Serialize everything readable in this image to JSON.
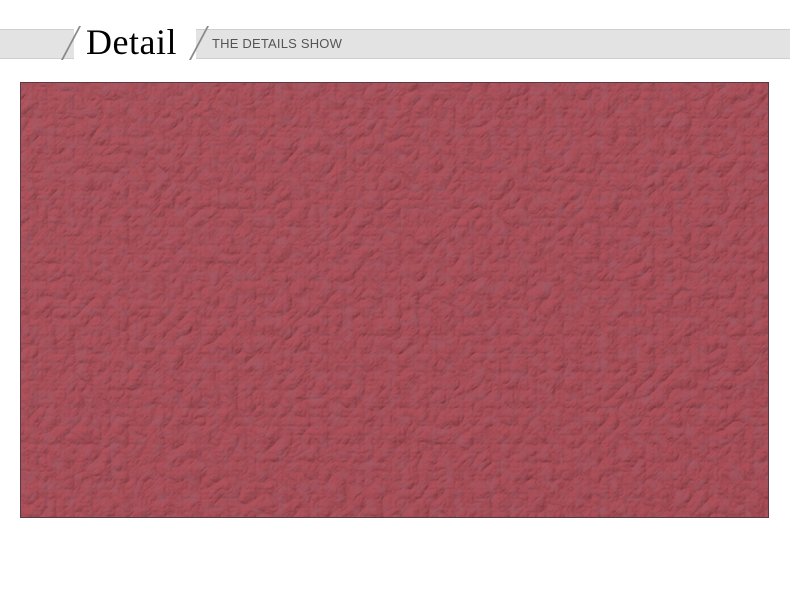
{
  "header": {
    "title": "Detail",
    "subtitle": "THE DETAILS SHOW"
  },
  "detail_image": {
    "subject": "pink-leather-texture",
    "colors": {
      "base": "#c06e78",
      "highlight": "#d89aa2",
      "shadow": "#8e4652"
    }
  }
}
